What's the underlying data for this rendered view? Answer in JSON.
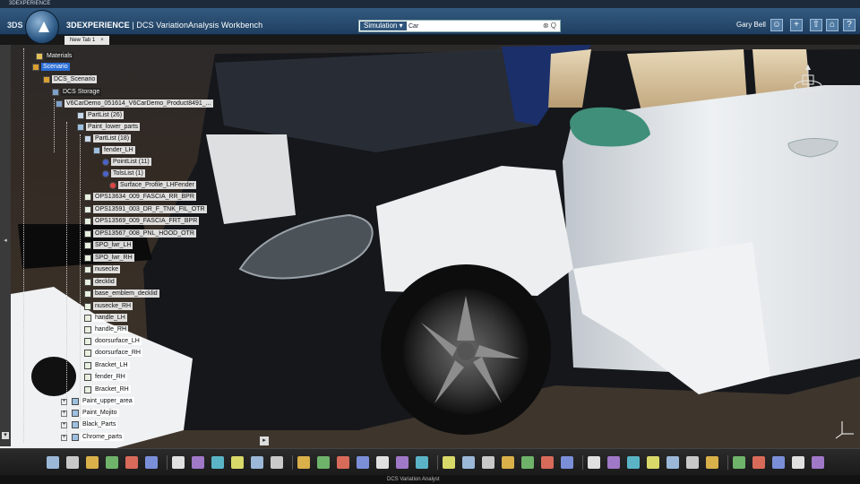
{
  "os_window_title": "3DEXPERIENCE",
  "header": {
    "brand": "3DEXPERIENCE",
    "separator": "|",
    "app_name": "DCS VariationAnalysis Workbench",
    "search_scope": "Simulation",
    "search_value": "Car",
    "search_icons": "⊗ Q̣",
    "user_name": "Gary Bell",
    "buttons": [
      "user-icon",
      "plus-icon",
      "share-icon",
      "home-icon",
      "help-icon"
    ]
  },
  "tabs": [
    {
      "label": "New Tab 1",
      "close": "×"
    }
  ],
  "tree": [
    {
      "label": "Materials",
      "icon": "folder-icon",
      "style": "dark"
    },
    {
      "label": "Scenario",
      "icon": "scenario-icon",
      "style": "sel"
    },
    {
      "label": "DCS_Scenario",
      "icon": "scenario-icon",
      "style": "light"
    },
    {
      "label": "DCS Storage",
      "icon": "storage-icon",
      "style": "dark"
    },
    {
      "label": "V6CarDemo_051614_V6CarDemo_Product8491_...",
      "icon": "product-icon",
      "style": "light"
    },
    {
      "label": "PartList (26)",
      "icon": "list-icon",
      "style": "light"
    },
    {
      "label": "Paint_lower_parts",
      "icon": "part-icon",
      "style": "light"
    },
    {
      "label": "PartList (18)",
      "icon": "list-icon",
      "style": "light"
    },
    {
      "label": "fender_LH",
      "icon": "part-icon",
      "style": "light"
    },
    {
      "label": "PointList (11)",
      "icon": "point-list-icon",
      "style": "light"
    },
    {
      "label": "TolsList (1)",
      "icon": "tolerance-list-icon",
      "style": "light"
    },
    {
      "label": "Surface_Profile_LHFender",
      "icon": "surface-profile-icon",
      "style": "light"
    },
    {
      "label": "OPS13634_009_FASCIA_RR_BPR",
      "icon": "feature-icon",
      "style": "light"
    },
    {
      "label": "OPS13591_003_DR_F_TNK_FIL_OTR",
      "icon": "feature-icon",
      "style": "light"
    },
    {
      "label": "OPS13569_009_FASCIA_FRT_BPR",
      "icon": "feature-icon",
      "style": "light"
    },
    {
      "label": "OPS13567_008_PNL_HOOD_OTR",
      "icon": "feature-icon",
      "style": "light"
    },
    {
      "label": "SPO_lwr_LH",
      "icon": "feature-icon",
      "style": "light"
    },
    {
      "label": "SPO_lwr_RH",
      "icon": "feature-icon",
      "style": "light"
    },
    {
      "label": "nusecke",
      "icon": "feature-icon",
      "style": "light"
    },
    {
      "label": "decklid",
      "icon": "feature-icon",
      "style": "light"
    },
    {
      "label": "base_emblem_decklid",
      "icon": "feature-icon",
      "style": "light"
    },
    {
      "label": "nusecke_RH",
      "icon": "feature-icon",
      "style": "light"
    },
    {
      "label": "handle_LH",
      "icon": "feature-icon",
      "style": "light"
    },
    {
      "label": "handle_RH",
      "icon": "feature-icon",
      "style": "light"
    },
    {
      "label": "doorsurface_LH",
      "icon": "feature-icon",
      "style": "light"
    },
    {
      "label": "doorsurface_RH",
      "icon": "feature-icon",
      "style": "light"
    },
    {
      "label": "Bracket_LH",
      "icon": "feature-icon",
      "style": "light"
    },
    {
      "label": "fender_RH",
      "icon": "feature-icon",
      "style": "light"
    },
    {
      "label": "Bracket_RH",
      "icon": "feature-icon",
      "style": "light"
    },
    {
      "label": "Paint_upper_area",
      "icon": "part-icon",
      "style": "light"
    },
    {
      "label": "Paint_Mojito",
      "icon": "part-icon",
      "style": "light"
    },
    {
      "label": "Black_Parts",
      "icon": "part-icon",
      "style": "light"
    },
    {
      "label": "Chrome_parts",
      "icon": "part-icon",
      "style": "light"
    }
  ],
  "toolbar_icons": [
    "cut-icon",
    "copy-icon",
    "paste-icon",
    "undo-icon",
    "update-icon",
    "select-icon",
    "measure-icon",
    "datum-icon",
    "feature-icon",
    "gen-icon",
    "texture-icon",
    "render-icon",
    "cube-icon",
    "sphere-icon",
    "section-icon",
    "analysis-icon",
    "point-icon",
    "move-icon",
    "tolerance-icon",
    "tolerance-list-icon",
    "assembly-icon",
    "move-icon-2",
    "contact-icon",
    "report-icon",
    "chart-icon",
    "bar-icon",
    "spline-icon",
    "document-icon",
    "binocular-icon",
    "tools-icon",
    "check-icon",
    "warning-icon",
    "folder-icon",
    "export-icon",
    "import-icon",
    "history-icon",
    "info-icon",
    "settings-icon"
  ],
  "status": "DCS Variation Analyst",
  "colors": {
    "header": "#2a4d72",
    "selection": "#2a6ed6",
    "car_body": "#e9ecef",
    "mirror": "#3f8f7a"
  }
}
